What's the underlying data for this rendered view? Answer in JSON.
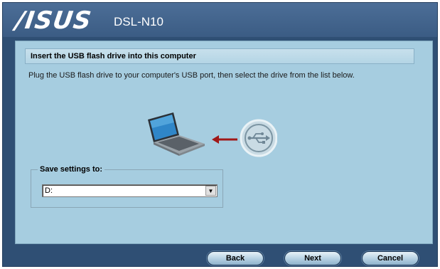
{
  "header": {
    "logo_text": "/ISUS",
    "model": "DSL-N10"
  },
  "section": {
    "title": "Insert the USB flash drive into this computer",
    "instruction": "Plug the USB flash drive to your computer's USB port, then select the drive from the list below."
  },
  "illustration": {
    "laptop_icon": "laptop-icon",
    "arrow_icon": "arrow-left-icon",
    "usb_icon": "usb-icon",
    "arrow_color": "#a01818"
  },
  "save_settings": {
    "label": "Save settings to:",
    "selected": "D:"
  },
  "buttons": {
    "back": "Back",
    "next": "Next",
    "cancel": "Cancel"
  }
}
